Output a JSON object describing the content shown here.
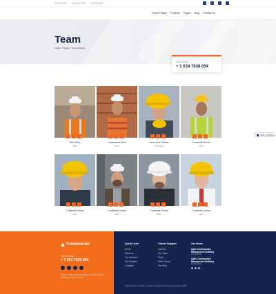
{
  "topbar": {
    "links": [
      "SUPPORT",
      "PARTNERS",
      "CAREERS"
    ]
  },
  "nav": {
    "items": [
      "Home Pages",
      "Projects",
      "Pages",
      "Blog",
      "Contact us"
    ]
  },
  "hero": {
    "title": "Team",
    "breadcrumb": "Home / Pages / Team Details"
  },
  "callcard": {
    "label": "Call us Now",
    "number": "+ 1 634 7638 654"
  },
  "team": [
    {
      "name": "Alex Dery",
      "role": "CEO"
    },
    {
      "name": "Josphkand Sora",
      "role": "CEO"
    },
    {
      "name": "Juan Jose Estese",
      "role": "Expertise"
    },
    {
      "name": "Corabella Dorsel",
      "role": "CEO"
    },
    {
      "name": "Corabella Dorsel",
      "role": "CEO"
    },
    {
      "name": "Corabella Dorsel",
      "role": "CEO"
    },
    {
      "name": "Corabella Dorsel",
      "role": "CEO"
    },
    {
      "name": "Corabella Dorsel",
      "role": "CEO"
    }
  ],
  "badge": {
    "text": "Made in Webflow"
  },
  "footer": {
    "logo": "Constructor",
    "call_label": "Call us Today",
    "call_number": "+ 1 634 7638 654",
    "description": "Fusce eu magna quis elit finibus vivamus. Vivamus sollicitudin magna ut lectus.",
    "quick_links_title": "Quick Links",
    "quick_links": [
      "Home",
      "About us",
      "Our Services",
      "Our Projects",
      "Contacts"
    ],
    "client_support_title": "Clients Support",
    "client_support": [
      "Careers",
      "Our Team",
      "FAQs",
      "Get in Touch",
      "Our Blog"
    ],
    "news_title": "Our News",
    "news": [
      {
        "title": "Agile Construction Management Building",
        "date": "29 May 2020"
      },
      {
        "title": "Agile Construction Management Building",
        "date": "29 May 2020"
      }
    ],
    "copyright": "Marksalone © Goalco Template All rights reserved Copyrights 2020"
  },
  "colors": {
    "accent": "#f26522",
    "navy": "#14244f"
  }
}
